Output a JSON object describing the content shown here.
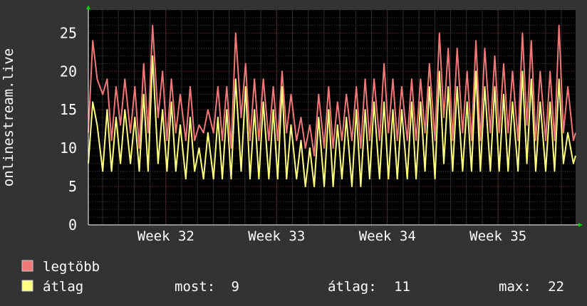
{
  "chart_data": {
    "type": "line",
    "ylabel": "onlinestream.live",
    "ylim": [
      0,
      28
    ],
    "y_ticks": [
      "0",
      "5",
      "10",
      "15",
      "20",
      "25"
    ],
    "x_tick_labels": [
      "Week 32",
      "Week 33",
      "Week 34",
      "Week 35"
    ],
    "x_tick_positions": [
      32,
      33,
      34,
      35
    ],
    "x_range": [
      31.3,
      35.7
    ],
    "grid": true,
    "series": [
      {
        "name": "legtöbb",
        "color": "#f07878",
        "x": [
          31.3,
          31.34,
          31.38,
          31.43,
          31.47,
          31.51,
          31.55,
          31.59,
          31.63,
          31.68,
          31.72,
          31.76,
          31.8,
          31.84,
          31.88,
          31.93,
          31.97,
          32.01,
          32.05,
          32.09,
          32.13,
          32.18,
          32.22,
          32.26,
          32.3,
          32.34,
          32.38,
          32.43,
          32.47,
          32.51,
          32.55,
          32.59,
          32.63,
          32.68,
          32.72,
          32.76,
          32.8,
          32.84,
          32.88,
          32.93,
          32.97,
          33.01,
          33.05,
          33.09,
          33.13,
          33.18,
          33.22,
          33.26,
          33.3,
          33.34,
          33.38,
          33.43,
          33.47,
          33.51,
          33.55,
          33.59,
          33.63,
          33.68,
          33.72,
          33.76,
          33.8,
          33.84,
          33.88,
          33.93,
          33.97,
          34.01,
          34.05,
          34.09,
          34.13,
          34.18,
          34.22,
          34.26,
          34.3,
          34.34,
          34.38,
          34.43,
          34.47,
          34.51,
          34.55,
          34.59,
          34.63,
          34.68,
          34.72,
          34.76,
          34.8,
          34.84,
          34.88,
          34.93,
          34.97,
          35.01,
          35.05,
          35.09,
          35.13,
          35.18,
          35.22,
          35.26,
          35.3,
          35.34,
          35.38,
          35.43,
          35.47,
          35.51,
          35.55,
          35.59,
          35.63,
          35.68,
          35.7
        ],
        "values": [
          12,
          24,
          19,
          17,
          19,
          11,
          18,
          13,
          19,
          12,
          18,
          10,
          21,
          12,
          26,
          14,
          20,
          11,
          19,
          12,
          17,
          11,
          18,
          11,
          13,
          12,
          15,
          12,
          18,
          11,
          18,
          10,
          25,
          14,
          21,
          11,
          19,
          11,
          19,
          11,
          18,
          11,
          20,
          12,
          17,
          11,
          14,
          10,
          13,
          9,
          17,
          10,
          18,
          10,
          16,
          11,
          17,
          11,
          18,
          10,
          19,
          11,
          19,
          11,
          21,
          12,
          19,
          11,
          18,
          11,
          19,
          11,
          19,
          12,
          21,
          11,
          25,
          14,
          23,
          11,
          23,
          12,
          20,
          11,
          24,
          11,
          23,
          12,
          22,
          12,
          21,
          12,
          20,
          11,
          25,
          13,
          24,
          11,
          20,
          11,
          20,
          11,
          26,
          12,
          18,
          11,
          12
        ]
      },
      {
        "name": "átlag",
        "color": "#ffff80",
        "x": [
          31.3,
          31.34,
          31.38,
          31.43,
          31.47,
          31.51,
          31.55,
          31.59,
          31.63,
          31.68,
          31.72,
          31.76,
          31.8,
          31.84,
          31.88,
          31.93,
          31.97,
          32.01,
          32.05,
          32.09,
          32.13,
          32.18,
          32.22,
          32.26,
          32.3,
          32.34,
          32.38,
          32.43,
          32.47,
          32.51,
          32.55,
          32.59,
          32.63,
          32.68,
          32.72,
          32.76,
          32.8,
          32.84,
          32.88,
          32.93,
          32.97,
          33.01,
          33.05,
          33.09,
          33.13,
          33.18,
          33.22,
          33.26,
          33.3,
          33.34,
          33.38,
          33.43,
          33.47,
          33.51,
          33.55,
          33.59,
          33.63,
          33.68,
          33.72,
          33.76,
          33.8,
          33.84,
          33.88,
          33.93,
          33.97,
          34.01,
          34.05,
          34.09,
          34.13,
          34.18,
          34.22,
          34.26,
          34.3,
          34.34,
          34.38,
          34.43,
          34.47,
          34.51,
          34.55,
          34.59,
          34.63,
          34.68,
          34.72,
          34.76,
          34.8,
          34.84,
          34.88,
          34.93,
          34.97,
          35.01,
          35.05,
          35.09,
          35.13,
          35.18,
          35.22,
          35.26,
          35.3,
          35.34,
          35.38,
          35.43,
          35.47,
          35.51,
          35.55,
          35.59,
          35.63,
          35.68,
          35.7
        ],
        "values": [
          8,
          16,
          13,
          7,
          15,
          7,
          14,
          8,
          15,
          8,
          14,
          7,
          17,
          7,
          22,
          8,
          15,
          7,
          16,
          7,
          13,
          6,
          14,
          7,
          10,
          6,
          12,
          6,
          14,
          6,
          15,
          6,
          19,
          7,
          18,
          6,
          15,
          6,
          16,
          6,
          15,
          6,
          18,
          6,
          13,
          6,
          11,
          5,
          10,
          5,
          14,
          5,
          15,
          5,
          13,
          6,
          14,
          5,
          15,
          5,
          15,
          6,
          16,
          6,
          16,
          6,
          15,
          6,
          15,
          6,
          16,
          6,
          16,
          7,
          18,
          6,
          20,
          8,
          18,
          7,
          18,
          7,
          16,
          7,
          20,
          7,
          18,
          7,
          18,
          7,
          17,
          7,
          16,
          7,
          20,
          8,
          19,
          7,
          16,
          7,
          16,
          7,
          19,
          8,
          12,
          8,
          9
        ]
      }
    ]
  },
  "legend": [
    {
      "label": "legtöbb",
      "color": "#f07878"
    },
    {
      "label": "átlag",
      "color": "#ffff80"
    }
  ],
  "stats": {
    "most_label": "most:",
    "most_value": "9",
    "atlag_label": "átlag:",
    "atlag_value": "11",
    "max_label": "max:",
    "max_value": "22"
  }
}
